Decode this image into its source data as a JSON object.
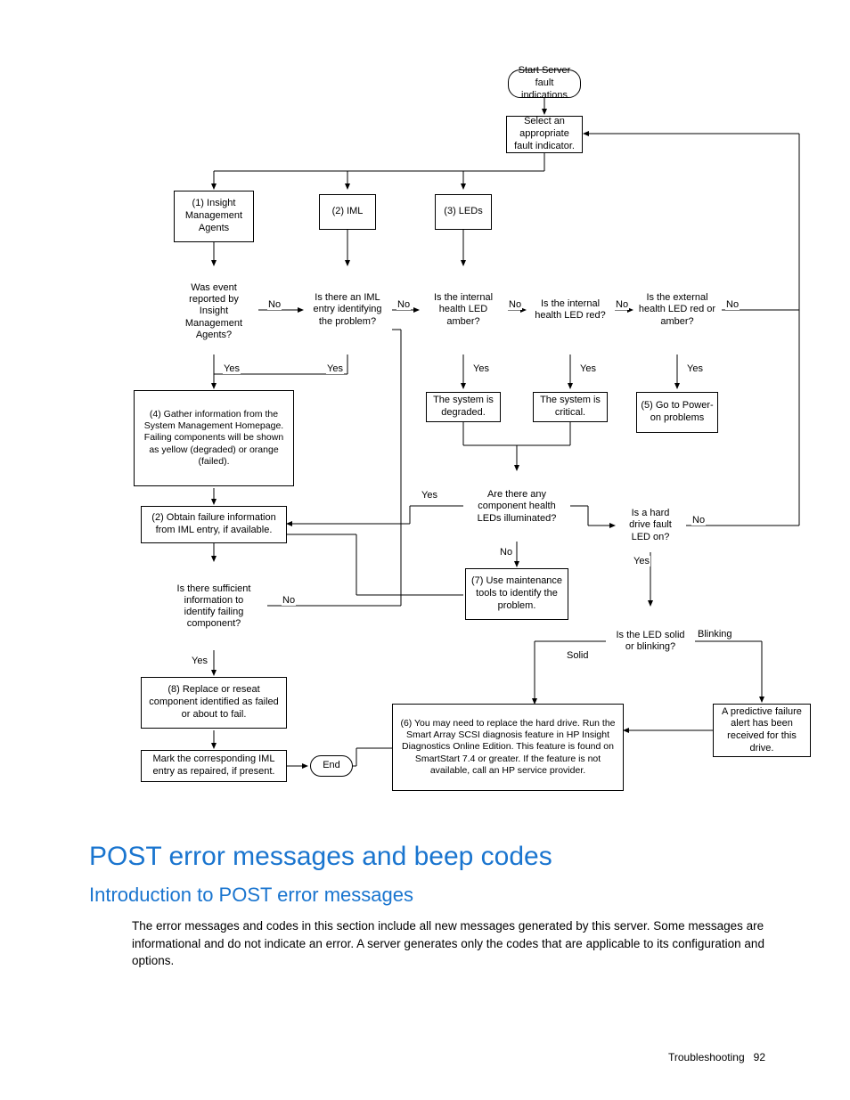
{
  "flow": {
    "start": "Start Server fault indications",
    "selectFault": "Select an appropriate fault indicator.",
    "opt1": "(1)\nInsight Management Agents",
    "opt2": "(2)\nIML",
    "opt3": "(3)\nLEDs",
    "d_eventReported": "Was event reported by Insight Management Agents?",
    "d_imlEntry": "Is there an IML entry identifying the problem?",
    "d_amber": "Is the internal health LED amber?",
    "d_red": "Is the internal health LED red?",
    "d_extLed": "Is the external health LED red or amber?",
    "degraded": "The system is degraded.",
    "critical": "The system is critical.",
    "powerOn": "(5)\nGo to Power-on problems",
    "gather4": "(4)\nGather information from the System Management Homepage. Failing components will be shown as yellow (degraded) or orange (failed).",
    "obtain2": "(2)\nObtain failure information from IML entry, if available.",
    "d_sufficient": "Is there sufficient information to identify failing component?",
    "d_compLeds": "Are there any component health LEDs illuminated?",
    "d_hdFault": "Is a hard drive fault LED on?",
    "useTools": "(7)\nUse maintenance tools to identify the problem.",
    "d_solidBlink": "Is the LED solid or blinking?",
    "replace8": "(8)\nReplace or reseat component identified as failed or about to fail.",
    "replaceHD": "(6)\nYou may need to replace the hard drive. Run the Smart Array SCSI diagnosis feature in HP Insight Diagnostics Online Edition. This feature is found on SmartStart 7.4 or greater. If the feature is not available, call an HP service provider.",
    "predictive": "A predictive failure alert has been received for this drive.",
    "markIML": "Mark the corresponding IML entry as repaired, if present.",
    "end": "End",
    "yes": "Yes",
    "no": "No",
    "solid": "Solid",
    "blinking": "Blinking"
  },
  "heading1": "POST error messages and beep codes",
  "heading2": "Introduction to POST error messages",
  "paragraph": "The error messages and codes in this section include all new messages generated by this server. Some messages are informational and do not indicate an error. A server generates only the codes that are applicable to its configuration and options.",
  "footerSection": "Troubleshooting",
  "footerPage": "92"
}
